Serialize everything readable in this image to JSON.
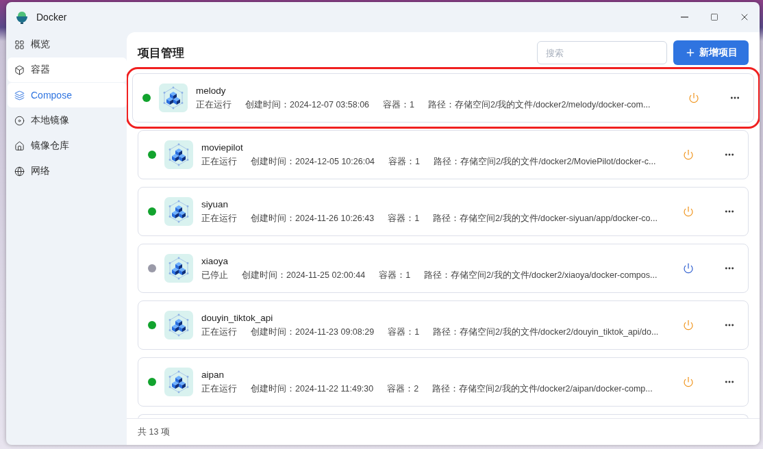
{
  "window": {
    "title": "Docker"
  },
  "sidebar": {
    "items": [
      {
        "label": "概览",
        "selected": false,
        "hovered": false
      },
      {
        "label": "容器",
        "selected": false,
        "hovered": true
      },
      {
        "label": "Compose",
        "selected": true,
        "hovered": false
      },
      {
        "label": "本地镜像",
        "selected": false,
        "hovered": false
      },
      {
        "label": "镜像仓库",
        "selected": false,
        "hovered": false
      },
      {
        "label": "网络",
        "selected": false,
        "hovered": false
      }
    ]
  },
  "header": {
    "title": "项目管理",
    "search": {
      "placeholder": "搜索"
    },
    "add_button": "新增项目"
  },
  "projects": [
    {
      "name": "melody",
      "running": true,
      "highlighted": true,
      "status": "正在运行",
      "created": "创建时间：2024-12-07 03:58:06",
      "containers": "容器：1",
      "path": "路径：存储空间2/我的文件/docker2/melody/docker-com..."
    },
    {
      "name": "moviepilot",
      "running": true,
      "highlighted": false,
      "status": "正在运行",
      "created": "创建时间：2024-12-05 10:26:04",
      "containers": "容器：1",
      "path": "路径：存储空间2/我的文件/docker2/MoviePilot/docker-c..."
    },
    {
      "name": "siyuan",
      "running": true,
      "highlighted": false,
      "status": "正在运行",
      "created": "创建时间：2024-11-26 10:26:43",
      "containers": "容器：1",
      "path": "路径：存储空间2/我的文件/docker-siyuan/app/docker-co..."
    },
    {
      "name": "xiaoya",
      "running": false,
      "highlighted": false,
      "status": "已停止",
      "created": "创建时间：2024-11-25 02:00:44",
      "containers": "容器：1",
      "path": "路径：存储空间2/我的文件/docker2/xiaoya/docker-compos..."
    },
    {
      "name": "douyin_tiktok_api",
      "running": true,
      "highlighted": false,
      "status": "正在运行",
      "created": "创建时间：2024-11-23 09:08:29",
      "containers": "容器：1",
      "path": "路径：存储空间2/我的文件/docker2/douyin_tiktok_api/do..."
    },
    {
      "name": "aipan",
      "running": true,
      "highlighted": false,
      "status": "正在运行",
      "created": "创建时间：2024-11-22 11:49:30",
      "containers": "容器：2",
      "path": "路径：存储空间2/我的文件/docker2/aipan/docker-comp..."
    }
  ],
  "footer": {
    "total": "共 13 项"
  }
}
